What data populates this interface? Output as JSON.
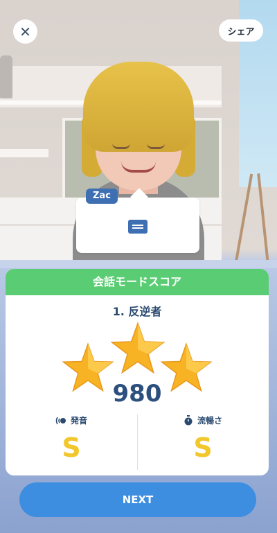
{
  "header": {
    "close_icon": "close-icon",
    "share_label": "シェア"
  },
  "conversation": {
    "speaker_name": "Zac",
    "message_icon": "message-icon"
  },
  "score_card": {
    "header": "会話モードスコア",
    "level_title": "1. 反逆者",
    "stars_earned": 3,
    "stars_total": 3,
    "score": "980",
    "metrics": [
      {
        "icon": "pronunciation-icon",
        "label": "発音",
        "grade": "S"
      },
      {
        "icon": "stopwatch-icon",
        "label": "流暢さ",
        "grade": "S"
      }
    ]
  },
  "footer": {
    "next_label": "NEXT"
  },
  "colors": {
    "accent_green": "#5acc73",
    "accent_blue": "#3d8ee0",
    "grade_yellow": "#f1c72c",
    "text_navy": "#2b4a6f"
  }
}
